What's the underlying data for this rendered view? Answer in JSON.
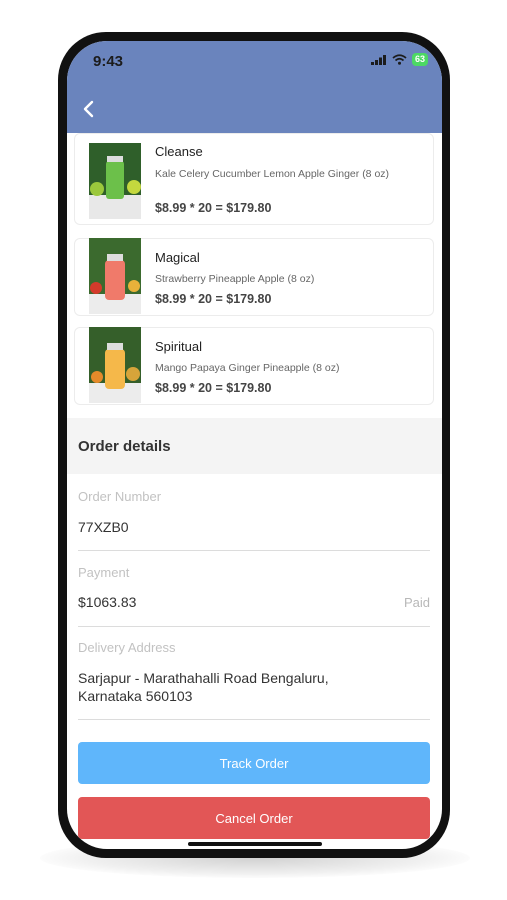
{
  "status_bar": {
    "time": "9:43",
    "battery": "63"
  },
  "products": [
    {
      "name": "Cleanse",
      "description": "Kale Celery Cucumber Lemon Apple Ginger (8 oz)",
      "price_line": "$8.99 * 20 = $179.80",
      "color": "#6cc04a"
    },
    {
      "name": "Magical",
      "description": "Strawberry Pineapple Apple (8 oz)",
      "price_line": "$8.99 * 20 = $179.80",
      "color": "#f07a6a"
    },
    {
      "name": "Spiritual",
      "description": "Mango Papaya Ginger Pineapple (8 oz)",
      "price_line": "$8.99 * 20 = $179.80",
      "color": "#f5b84a"
    }
  ],
  "order_details": {
    "title": "Order details",
    "order_number_label": "Order Number",
    "order_number": "77XZB0",
    "payment_label": "Payment",
    "payment_amount": "$1063.83",
    "payment_status": "Paid",
    "address_label": "Delivery Address",
    "address_line1": "Sarjapur - Marathahalli Road Bengaluru,",
    "address_line2": "Karnataka 560103"
  },
  "actions": {
    "track_label": "Track Order",
    "cancel_label": "Cancel Order"
  },
  "icons": {
    "back": "back-arrow-icon",
    "signal": "signal-icon",
    "wifi": "wifi-icon",
    "battery": "battery-icon"
  },
  "colors": {
    "header": "#6a84bd",
    "track": "#5fb6fb",
    "cancel": "#e25656"
  }
}
